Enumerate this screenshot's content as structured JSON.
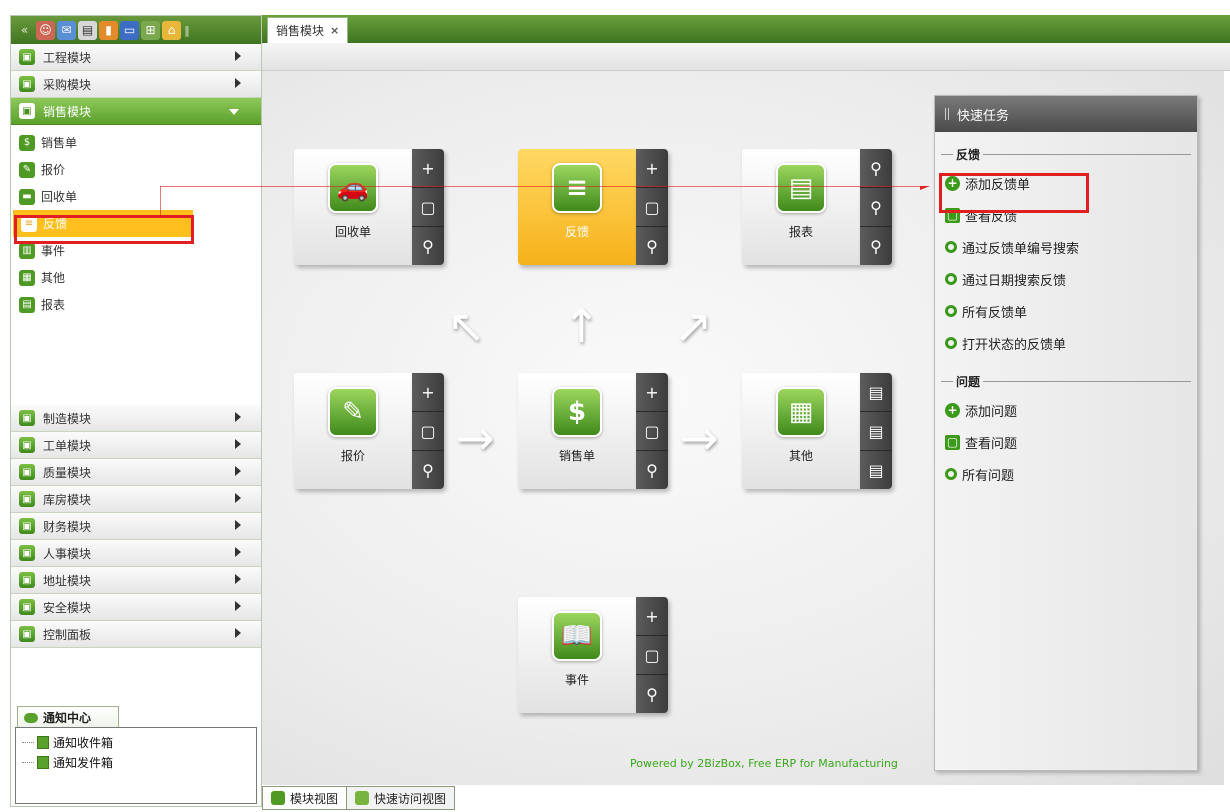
{
  "toolbar": {
    "buttons": [
      "collapse-icon",
      "users-icon",
      "mail-icon",
      "docs-icon",
      "chart-icon",
      "monitor-icon",
      "sitemap-icon",
      "home-icon",
      "grip-icon"
    ]
  },
  "left_nav": {
    "modules_top": [
      {
        "label": "工程模块"
      },
      {
        "label": "采购模块"
      }
    ],
    "active_module": {
      "label": "销售模块"
    },
    "sub_items": [
      {
        "label": "销售单"
      },
      {
        "label": "报价"
      },
      {
        "label": "回收单"
      },
      {
        "label": "反馈"
      },
      {
        "label": "事件"
      },
      {
        "label": "其他"
      },
      {
        "label": "报表"
      }
    ],
    "modules_bottom": [
      {
        "label": "制造模块"
      },
      {
        "label": "工单模块"
      },
      {
        "label": "质量模块"
      },
      {
        "label": "库房模块"
      },
      {
        "label": "财务模块"
      },
      {
        "label": "人事模块"
      },
      {
        "label": "地址模块"
      },
      {
        "label": "安全模块"
      },
      {
        "label": "控制面板"
      }
    ],
    "notify": {
      "tab_label": "通知中心",
      "items": [
        {
          "label": "通知收件箱"
        },
        {
          "label": "通知发件箱"
        }
      ]
    }
  },
  "main": {
    "tab_label": "销售模块",
    "tab_close": "×",
    "cards": [
      {
        "label": "回收单",
        "glyph": "🚗"
      },
      {
        "label": "反馈",
        "glyph": "≡"
      },
      {
        "label": "报表",
        "glyph": "▤"
      },
      {
        "label": "报价",
        "glyph": "✎"
      },
      {
        "label": "销售单",
        "glyph": "$"
      },
      {
        "label": "其他",
        "glyph": "▦"
      },
      {
        "label": "事件",
        "glyph": "📖"
      }
    ],
    "powered": "Powered by 2BizBox, Free ERP for Manufacturing"
  },
  "quick_tasks": {
    "title": "快速任务",
    "groups": [
      {
        "title": "反馈",
        "items": [
          {
            "label": "添加反馈单",
            "icon": "plus"
          },
          {
            "label": "查看反馈",
            "icon": "view"
          },
          {
            "label": "通过反馈单编号搜索",
            "icon": "search"
          },
          {
            "label": "通过日期搜索反馈",
            "icon": "search"
          },
          {
            "label": "所有反馈单",
            "icon": "search"
          },
          {
            "label": "打开状态的反馈单",
            "icon": "search"
          }
        ]
      },
      {
        "title": "问题",
        "items": [
          {
            "label": "添加问题",
            "icon": "plus"
          },
          {
            "label": "查看问题",
            "icon": "view"
          },
          {
            "label": "所有问题",
            "icon": "search"
          }
        ]
      }
    ]
  },
  "bottom_tabs": [
    {
      "label": "模块视图"
    },
    {
      "label": "快速访问视图"
    }
  ],
  "colors": {
    "brand_green": "#4e9a22",
    "highlight": "#ffbf1f",
    "annotation_red": "#e02020"
  }
}
